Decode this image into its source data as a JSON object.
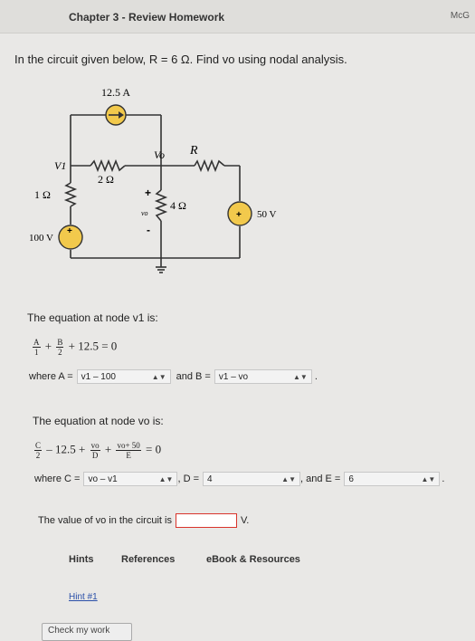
{
  "header": {
    "title": "Chapter 3 - Review Homework",
    "brand": "McG"
  },
  "question": "In the circuit given below, R = 6 Ω. Find vo using nodal analysis.",
  "circuit": {
    "current_source": "12.5 A",
    "v1_label": "V1",
    "vo_label": "Vo",
    "r_label": "R",
    "r_2ohm": "2 Ω",
    "r_1ohm": "1 Ω",
    "r_4ohm": "4 Ω",
    "src_100": "100 V",
    "src_50": "50 V",
    "vo_small": "vo",
    "plus": "+",
    "minus": "-"
  },
  "eq1": {
    "title": "The equation at node v1 is:",
    "frac1_num": "A",
    "frac1_den": "1",
    "plus1": "+",
    "frac2_num": "B",
    "frac2_den": "2",
    "tail": "+ 12.5  =  0",
    "where_a": "where A =",
    "a_value": "v1 – 100",
    "and_b": "and B =",
    "b_value": "v1 – vo"
  },
  "eq2": {
    "title": "The equation at node vo is:",
    "frac1_num": "C",
    "frac1_den": "2",
    "mid": "– 12.5  +",
    "frac2_num": "vo",
    "frac2_den": "D",
    "plus": "+",
    "frac3_num": "vo+ 50",
    "frac3_den": "E",
    "tail": "=  0",
    "where_c": "where C =",
    "c_value": "vo – v1",
    "d_label": ", D =",
    "d_value": "4",
    "e_label": ", and E =",
    "e_value": "6"
  },
  "answer": {
    "label": "The value of vo in the circuit is",
    "unit": "V."
  },
  "tabs": {
    "hints": "Hints",
    "references": "References",
    "ebook": "eBook & Resources"
  },
  "hint1": "Hint #1",
  "check": "Check my work"
}
